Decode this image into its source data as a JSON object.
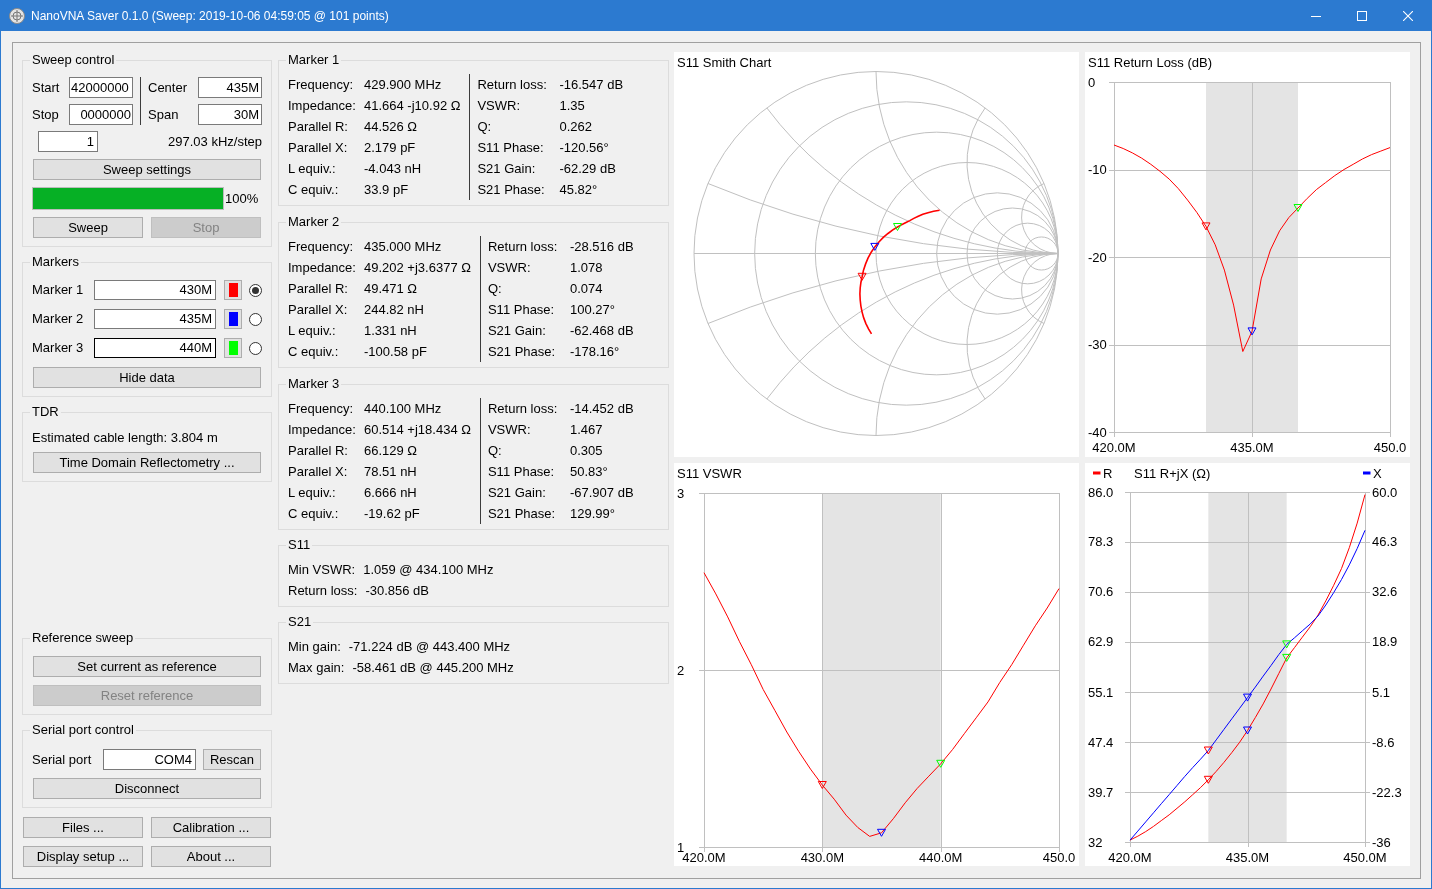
{
  "window": {
    "title": "NanoVNA Saver 0.1.0 (Sweep: 2019-10-06 04:59:05 @ 101 points)"
  },
  "sweep_control": {
    "title": "Sweep control",
    "start": {
      "label": "Start",
      "value": "42000000"
    },
    "center": {
      "label": "Center",
      "value": "435M"
    },
    "stop": {
      "label": "Stop",
      "value": "0000000"
    },
    "span": {
      "label": "Span",
      "value": "30M"
    },
    "segments": "1",
    "step": "297.03 kHz/step",
    "settings_button": "Sweep settings",
    "progress": {
      "level": 1,
      "reading": "100%"
    },
    "buttons": [
      {
        "label": "Sweep",
        "disabled": false
      },
      {
        "label": "Stop",
        "disabled": true
      }
    ]
  },
  "markers": {
    "title": "Markers",
    "items": [
      {
        "label": "Marker 1",
        "value": "430M",
        "color": "#ff0000",
        "selected": true,
        "focused": false
      },
      {
        "label": "Marker 2",
        "value": "435M",
        "color": "#0000ff",
        "selected": false,
        "focused": false
      },
      {
        "label": "Marker 3",
        "value": "440M",
        "color": "#00ff00",
        "selected": false,
        "focused": true
      }
    ],
    "hide_button": "Hide data"
  },
  "tdr": {
    "title": "TDR",
    "estimate": "Estimated cable length: 3.804 m",
    "button": "Time Domain Reflectometry ..."
  },
  "reference_sweep": {
    "title": "Reference sweep",
    "buttons": [
      {
        "label": "Set current as reference",
        "disabled": false
      },
      {
        "label": "Reset reference",
        "disabled": true
      }
    ]
  },
  "serial_port": {
    "title": "Serial port control",
    "label": "Serial port",
    "port": "COM4",
    "rescan_button": "Rescan",
    "connect_button": "Disconnect"
  },
  "bottom_buttons": [
    "Files ...",
    "Calibration ...",
    "Display setup ...",
    "About ..."
  ],
  "marker_details": [
    {
      "title": "Marker 1",
      "left": [
        {
          "label": "Frequency:",
          "value": "429.900 MHz"
        },
        {
          "label": "Impedance:",
          "value": "41.664 -j10.92 Ω"
        },
        {
          "label": "Parallel R:",
          "value": "44.526 Ω"
        },
        {
          "label": "Parallel X:",
          "value": "2.179 pF"
        },
        {
          "label": "L equiv.:",
          "value": "-4.043 nH"
        },
        {
          "label": "C equiv.:",
          "value": "33.9 pF"
        }
      ],
      "right": [
        {
          "label": "Return loss:",
          "value": "-16.547 dB"
        },
        {
          "label": "VSWR:",
          "value": "1.35"
        },
        {
          "label": "Q:",
          "value": "0.262"
        },
        {
          "label": "S11 Phase:",
          "value": "-120.56°"
        },
        {
          "label": "S21 Gain:",
          "value": "-62.29 dB"
        },
        {
          "label": "S21 Phase:",
          "value": "45.82°"
        }
      ]
    },
    {
      "title": "Marker 2",
      "left": [
        {
          "label": "Frequency:",
          "value": "435.000 MHz"
        },
        {
          "label": "Impedance:",
          "value": "49.202 +j3.6377 Ω"
        },
        {
          "label": "Parallel R:",
          "value": "49.471 Ω"
        },
        {
          "label": "Parallel X:",
          "value": "244.82 nH"
        },
        {
          "label": "L equiv.:",
          "value": "1.331 nH"
        },
        {
          "label": "C equiv.:",
          "value": "-100.58 pF"
        }
      ],
      "right": [
        {
          "label": "Return loss:",
          "value": "-28.516 dB"
        },
        {
          "label": "VSWR:",
          "value": "1.078"
        },
        {
          "label": "Q:",
          "value": "0.074"
        },
        {
          "label": "S11 Phase:",
          "value": "100.27°"
        },
        {
          "label": "S21 Gain:",
          "value": "-62.468 dB"
        },
        {
          "label": "S21 Phase:",
          "value": "-178.16°"
        }
      ]
    },
    {
      "title": "Marker 3",
      "left": [
        {
          "label": "Frequency:",
          "value": "440.100 MHz"
        },
        {
          "label": "Impedance:",
          "value": "60.514 +j18.434 Ω"
        },
        {
          "label": "Parallel R:",
          "value": "66.129 Ω"
        },
        {
          "label": "Parallel X:",
          "value": "78.51 nH"
        },
        {
          "label": "L equiv.:",
          "value": "6.666 nH"
        },
        {
          "label": "C equiv.:",
          "value": "-19.62 pF"
        }
      ],
      "right": [
        {
          "label": "Return loss:",
          "value": "-14.452 dB"
        },
        {
          "label": "VSWR:",
          "value": "1.467"
        },
        {
          "label": "Q:",
          "value": "0.305"
        },
        {
          "label": "S11 Phase:",
          "value": "50.83°"
        },
        {
          "label": "S21 Gain:",
          "value": "-67.907 dB"
        },
        {
          "label": "S21 Phase:",
          "value": "129.99°"
        }
      ]
    }
  ],
  "summaries": [
    {
      "title": "S11",
      "rows": [
        {
          "label": "Min VSWR:",
          "value": "1.059 @ 434.100 MHz"
        },
        {
          "label": "Return loss:",
          "value": "-30.856 dB"
        }
      ]
    },
    {
      "title": "S21",
      "rows": [
        {
          "label": "Min gain:",
          "value": "-71.224 dB @ 443.400 MHz"
        },
        {
          "label": "Max gain:",
          "value": "-58.461 dB @ 445.200 MHz"
        }
      ]
    }
  ],
  "charts": [
    {
      "kind": "smith",
      "title": "S11 Smith Chart"
    },
    {
      "kind": "plot",
      "chart_data": {
        "type": "line",
        "title": "S11 Return Loss (dB)",
        "x": [
          420,
          421,
          422,
          423,
          424,
          425,
          426,
          427,
          428,
          429,
          430,
          431,
          432,
          433,
          434,
          435,
          436,
          437,
          438,
          439,
          440,
          441,
          442,
          443,
          444,
          445,
          446,
          447,
          448,
          449,
          450
        ],
        "series": [
          {
            "color": "#ff0000",
            "values": [
              -7.2,
              -7.6,
              -8.1,
              -8.7,
              -9.4,
              -10.2,
              -11.1,
              -12.2,
              -13.5,
              -14.9,
              -16.5,
              -18.6,
              -21.5,
              -25.5,
              -30.8,
              -28.5,
              -22.5,
              -19.2,
              -17.0,
              -15.5,
              -14.4,
              -13.3,
              -12.3,
              -11.5,
              -10.7,
              -10.0,
              -9.4,
              -8.8,
              -8.3,
              -7.9,
              -7.5
            ]
          },
          {
            "type": "scatter",
            "color": "#ff0000",
            "values": [
              null,
              null,
              null,
              null,
              null,
              null,
              null,
              null,
              null,
              null,
              -16.5,
              null,
              null,
              null,
              null,
              null,
              null,
              null,
              null,
              null,
              null,
              null,
              null,
              null,
              null,
              null,
              null,
              null,
              null,
              null,
              null
            ]
          },
          {
            "type": "scatter",
            "color": "#0000ff",
            "values": [
              null,
              null,
              null,
              null,
              null,
              null,
              null,
              null,
              null,
              null,
              null,
              null,
              null,
              null,
              null,
              -28.5,
              null,
              null,
              null,
              null,
              null,
              null,
              null,
              null,
              null,
              null,
              null,
              null,
              null,
              null,
              null
            ]
          },
          {
            "type": "scatter",
            "color": "#00ff00",
            "values": [
              null,
              null,
              null,
              null,
              null,
              null,
              null,
              null,
              null,
              null,
              null,
              null,
              null,
              null,
              null,
              null,
              null,
              null,
              null,
              null,
              -14.4,
              null,
              null,
              null,
              null,
              null,
              null,
              null,
              null,
              null,
              null
            ]
          }
        ],
        "xlim": [
          420,
          450
        ],
        "ylim": [
          -40,
          0
        ],
        "xticks": [
          {
            "value": 420,
            "label": "420.0M"
          },
          {
            "value": 435,
            "label": "435.0M"
          },
          {
            "value": 450,
            "label": "450.0"
          }
        ],
        "yticks": [
          0,
          -10,
          -20,
          -30,
          -40
        ],
        "grid": true,
        "bands": [
          {
            "axis": "x",
            "from": 430,
            "to": 440
          }
        ]
      }
    },
    {
      "kind": "plot",
      "chart_data": {
        "type": "line",
        "title": "S11 VSWR",
        "x": [
          420,
          421,
          422,
          423,
          424,
          425,
          426,
          427,
          428,
          429,
          430,
          431,
          432,
          433,
          434,
          435,
          436,
          437,
          438,
          439,
          440,
          441,
          442,
          443,
          444,
          445,
          446,
          447,
          448,
          449,
          450
        ],
        "series": [
          {
            "color": "#ff0000",
            "values": [
              2.55,
              2.43,
              2.3,
              2.16,
              2.03,
              1.89,
              1.77,
              1.65,
              1.54,
              1.44,
              1.35,
              1.27,
              1.18,
              1.11,
              1.06,
              1.08,
              1.16,
              1.25,
              1.33,
              1.4,
              1.47,
              1.55,
              1.64,
              1.73,
              1.82,
              1.93,
              2.03,
              2.14,
              2.25,
              2.35,
              2.46
            ]
          },
          {
            "type": "scatter",
            "color": "#ff0000",
            "values": [
              null,
              null,
              null,
              null,
              null,
              null,
              null,
              null,
              null,
              null,
              1.35,
              null,
              null,
              null,
              null,
              null,
              null,
              null,
              null,
              null,
              null,
              null,
              null,
              null,
              null,
              null,
              null,
              null,
              null,
              null,
              null
            ]
          },
          {
            "type": "scatter",
            "color": "#0000ff",
            "values": [
              null,
              null,
              null,
              null,
              null,
              null,
              null,
              null,
              null,
              null,
              null,
              null,
              null,
              null,
              null,
              1.08,
              null,
              null,
              null,
              null,
              null,
              null,
              null,
              null,
              null,
              null,
              null,
              null,
              null,
              null,
              null
            ]
          },
          {
            "type": "scatter",
            "color": "#00ff00",
            "values": [
              null,
              null,
              null,
              null,
              null,
              null,
              null,
              null,
              null,
              null,
              null,
              null,
              null,
              null,
              null,
              null,
              null,
              null,
              null,
              null,
              1.47,
              null,
              null,
              null,
              null,
              null,
              null,
              null,
              null,
              null,
              null
            ]
          }
        ],
        "xlim": [
          420,
          450
        ],
        "ylim": [
          1,
          3
        ],
        "xticks": [
          {
            "value": 420,
            "label": "420.0M"
          },
          {
            "value": 430,
            "label": "430.0M"
          },
          {
            "value": 440,
            "label": "440.0M"
          },
          {
            "value": 450,
            "label": "450.0"
          }
        ],
        "yticks": [
          1,
          2,
          3
        ],
        "grid": true,
        "bands": [
          {
            "axis": "x",
            "from": 430,
            "to": 440
          }
        ]
      }
    },
    {
      "kind": "plot",
      "chart_data": {
        "type": "line",
        "title": "S11 R+jX (Ω)",
        "x": [
          420,
          421,
          422,
          423,
          424,
          425,
          426,
          427,
          428,
          429,
          430,
          431,
          432,
          433,
          434,
          435,
          436,
          437,
          438,
          439,
          440,
          441,
          442,
          443,
          444,
          445,
          446,
          447,
          448,
          449,
          450
        ],
        "series": [
          {
            "name": "R",
            "color": "#ff0000",
            "values": [
              32.3,
              32.9,
              33.6,
              34.4,
              35.3,
              36.2,
              37.2,
              38.2,
              39.3,
              40.4,
              41.6,
              42.9,
              44.3,
              45.8,
              47.4,
              49.2,
              51.2,
              53.3,
              55.6,
              58.0,
              60.4,
              62.0,
              63.6,
              65.2,
              67.0,
              69.2,
              71.6,
              74.2,
              77.4,
              81.2,
              85.6
            ]
          },
          {
            "name": "X",
            "color": "#0000ff",
            "axis": "y2",
            "values": [
              -35.5,
              -33.0,
              -30.5,
              -28.0,
              -25.5,
              -23.0,
              -20.5,
              -18.0,
              -15.6,
              -13.3,
              -10.9,
              -8.0,
              -5.1,
              -2.2,
              0.7,
              3.6,
              6.5,
              9.5,
              12.4,
              15.4,
              18.2,
              20.0,
              21.9,
              23.8,
              26.0,
              29.0,
              32.4,
              36.0,
              40.0,
              44.5,
              49.5
            ]
          },
          {
            "type": "scatter",
            "color": "#ff0000",
            "values": [
              null,
              null,
              null,
              null,
              null,
              null,
              null,
              null,
              null,
              null,
              41.6,
              null,
              null,
              null,
              null,
              null,
              null,
              null,
              null,
              null,
              null,
              null,
              null,
              null,
              null,
              null,
              null,
              null,
              null,
              null,
              null
            ]
          },
          {
            "type": "scatter",
            "color": "#0000ff",
            "values": [
              null,
              null,
              null,
              null,
              null,
              null,
              null,
              null,
              null,
              null,
              null,
              null,
              null,
              null,
              null,
              49.2,
              null,
              null,
              null,
              null,
              null,
              null,
              null,
              null,
              null,
              null,
              null,
              null,
              null,
              null,
              null
            ]
          },
          {
            "type": "scatter",
            "color": "#00ff00",
            "values": [
              null,
              null,
              null,
              null,
              null,
              null,
              null,
              null,
              null,
              null,
              null,
              null,
              null,
              null,
              null,
              null,
              null,
              null,
              null,
              null,
              60.4,
              null,
              null,
              null,
              null,
              null,
              null,
              null,
              null,
              null,
              null
            ]
          },
          {
            "type": "scatter",
            "color": "#ff0000",
            "axis": "y2",
            "values": [
              null,
              null,
              null,
              null,
              null,
              null,
              null,
              null,
              null,
              null,
              -10.9,
              null,
              null,
              null,
              null,
              null,
              null,
              null,
              null,
              null,
              null,
              null,
              null,
              null,
              null,
              null,
              null,
              null,
              null,
              null,
              null
            ]
          },
          {
            "type": "scatter",
            "color": "#0000ff",
            "axis": "y2",
            "values": [
              null,
              null,
              null,
              null,
              null,
              null,
              null,
              null,
              null,
              null,
              null,
              null,
              null,
              null,
              null,
              3.6,
              null,
              null,
              null,
              null,
              null,
              null,
              null,
              null,
              null,
              null,
              null,
              null,
              null,
              null,
              null
            ]
          },
          {
            "type": "scatter",
            "color": "#00ff00",
            "axis": "y2",
            "values": [
              null,
              null,
              null,
              null,
              null,
              null,
              null,
              null,
              null,
              null,
              null,
              null,
              null,
              null,
              null,
              null,
              null,
              null,
              null,
              null,
              18.2,
              null,
              null,
              null,
              null,
              null,
              null,
              null,
              null,
              null,
              null
            ]
          }
        ],
        "xlim": [
          420,
          450
        ],
        "ylim": [
          32,
          86
        ],
        "y2lim": [
          -36,
          60
        ],
        "xticks": [
          {
            "value": 420,
            "label": "420.0M"
          },
          {
            "value": 435,
            "label": "435.0M"
          },
          {
            "value": 450,
            "label": "450.0M"
          }
        ],
        "yticks": [
          32,
          39.7,
          47.4,
          55.1,
          62.9,
          70.6,
          78.3,
          {
            "value": 86,
            "label": "86.0"
          }
        ],
        "y2ticks": [
          -36,
          -22.3,
          -8.6,
          5.1,
          18.9,
          32.6,
          46.3,
          {
            "value": 60,
            "label": "60.0"
          }
        ],
        "grid": true,
        "legend": "top",
        "bands": [
          {
            "axis": "x",
            "from": 430,
            "to": 440
          }
        ]
      }
    }
  ]
}
